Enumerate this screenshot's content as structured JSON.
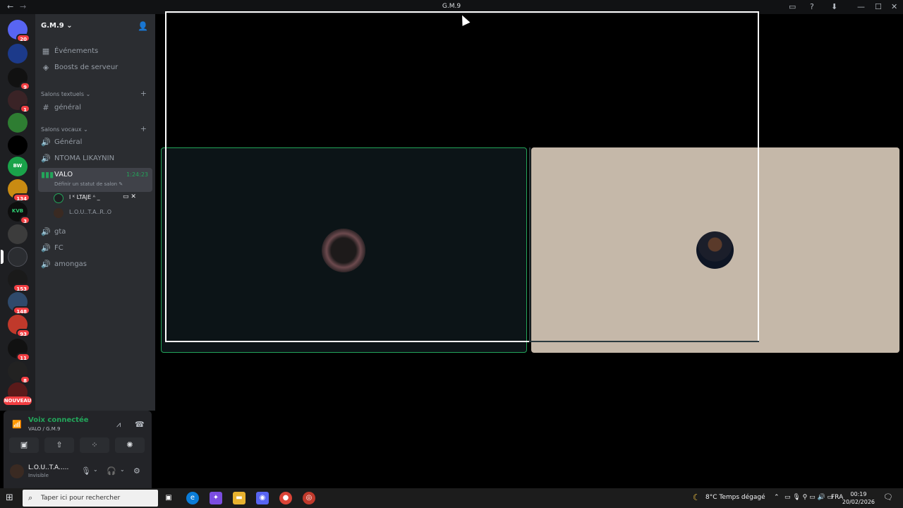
{
  "window": {
    "title": "G.M.9",
    "back": "←",
    "forward": "→",
    "controls": [
      "▭",
      "?",
      "⬇",
      "—",
      "☐",
      "✕"
    ]
  },
  "rail": {
    "badges": [
      "20",
      "9",
      "1",
      "134",
      "3",
      "153",
      "148",
      "93",
      "11",
      "8"
    ],
    "bw_label": "BW",
    "kvb_label": "KVB",
    "nouveau": "NOUVEAU"
  },
  "server": {
    "name": "G.M.9 ⌄",
    "events": "Événements",
    "boosts": "Boosts de serveur",
    "text_category": "Salons textuels ⌄",
    "voice_category": "Salons vocaux ⌄",
    "add": "+",
    "text_channels": [
      "général"
    ],
    "voice_channels": [
      "Général",
      "NTOMA LIKAYNIN"
    ],
    "active_channel": "VALO",
    "active_time": "1:24:23",
    "active_status": "Définir un statut de salon ✎",
    "voice_users": [
      "l ᴷ LTAJE ᴬ _",
      "L.O.U..T.A..R..O"
    ],
    "other_channels": [
      "gta",
      "FC",
      "amongas"
    ]
  },
  "voice_panel": {
    "status": "Voix connectée",
    "channel": "VALO / G.M.9",
    "buttons": [
      "▣̸",
      "⇧",
      "⁘",
      "✺"
    ]
  },
  "user": {
    "name": "L.O.U..T.A.....",
    "status": "Invisible"
  },
  "taskbar": {
    "search_placeholder": "Taper ici pour rechercher",
    "weather": "8°C  Temps dégagé",
    "lang": "FRA",
    "time": "00:19",
    "date": "20/02/2026"
  },
  "colors": {
    "accent_green": "#23a55a",
    "badge_red": "#f23f43",
    "tile_right": "#c5b8a9"
  }
}
